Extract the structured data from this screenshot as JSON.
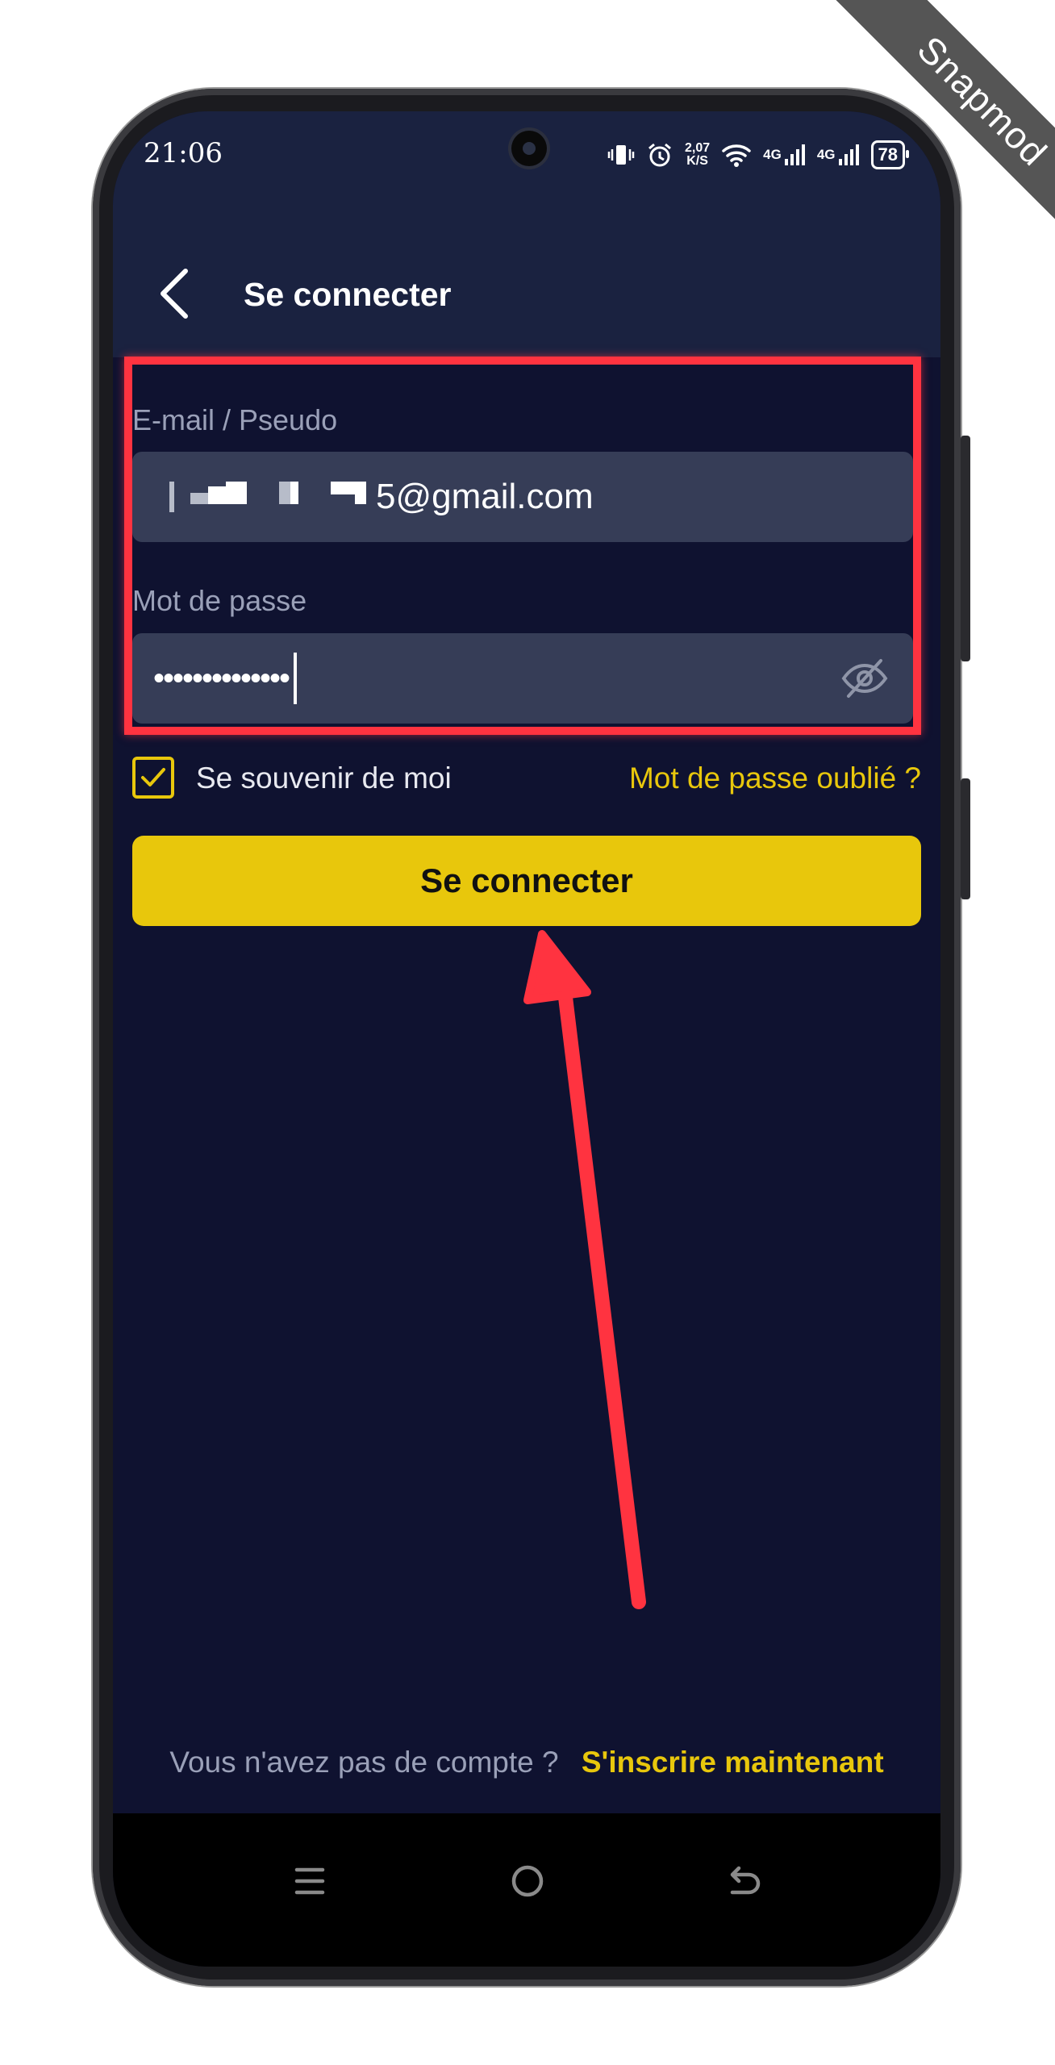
{
  "watermark": "Snapmod",
  "status_bar": {
    "time": "21:06",
    "speed_value": "2,07",
    "speed_unit": "K/S",
    "network_1": "4G",
    "network_2": "4G",
    "battery": "78",
    "icons": [
      "vibrate-icon",
      "alarm-icon",
      "wifi-icon",
      "signal-icon",
      "signal-icon",
      "battery-icon"
    ]
  },
  "header": {
    "title": "Se connecter"
  },
  "form": {
    "email_label": "E-mail / Pseudo",
    "email_value_visible": "5@gmail.com",
    "password_label": "Mot de passe",
    "password_value": "••••••••••••••",
    "remember_label": "Se souvenir de moi",
    "remember_checked": true,
    "forgot_link": "Mot de passe oublié ?",
    "submit_label": "Se connecter"
  },
  "footer": {
    "question": "Vous n'avez pas de compte ?",
    "signup_link": "S'inscrire maintenant"
  },
  "colors": {
    "accent": "#e8c70c",
    "background": "#0f1230",
    "appbar": "#1a2240",
    "field": "#363d57",
    "annotation": "#ff3340"
  }
}
